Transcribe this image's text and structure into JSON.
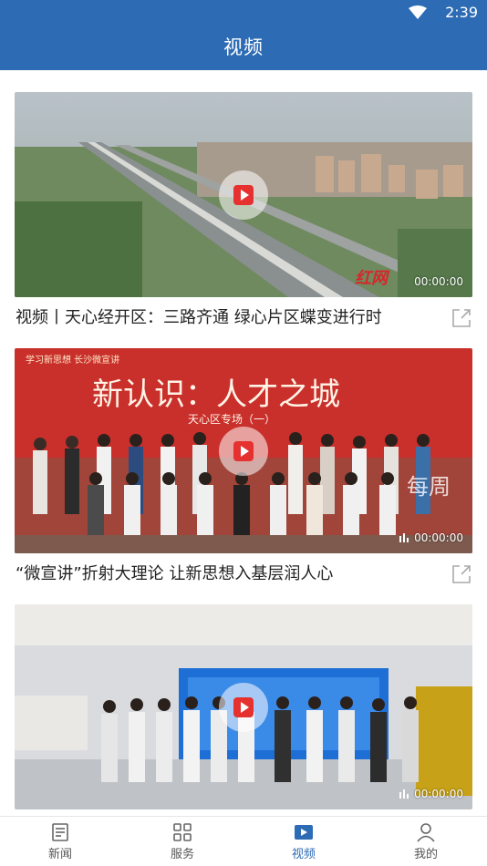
{
  "status": {
    "time": "2:39"
  },
  "header": {
    "title": "视频"
  },
  "videos": [
    {
      "title": "视频丨天心经开区：三路齐通 绿心片区蝶变进行时",
      "duration": "00:00:00",
      "watermark": "红网"
    },
    {
      "title": "“微宣讲”折射大理论 让新思想入基层润人心",
      "duration": "00:00:00",
      "banner_line1": "学习新思想 长沙微宣讲",
      "banner_heading": "新认识：人才之城",
      "banner_sub": "天心区专场（一）",
      "corner_text": "每周"
    },
    {
      "title": "",
      "duration": "00:00:00"
    }
  ],
  "tabs": [
    {
      "label": "新闻",
      "icon": "news-icon",
      "active": false
    },
    {
      "label": "服务",
      "icon": "grid-icon",
      "active": false
    },
    {
      "label": "视频",
      "icon": "video-icon",
      "active": true
    },
    {
      "label": "我的",
      "icon": "user-icon",
      "active": false
    }
  ],
  "colors": {
    "accent": "#2d6cb5",
    "play": "#e5312f"
  }
}
